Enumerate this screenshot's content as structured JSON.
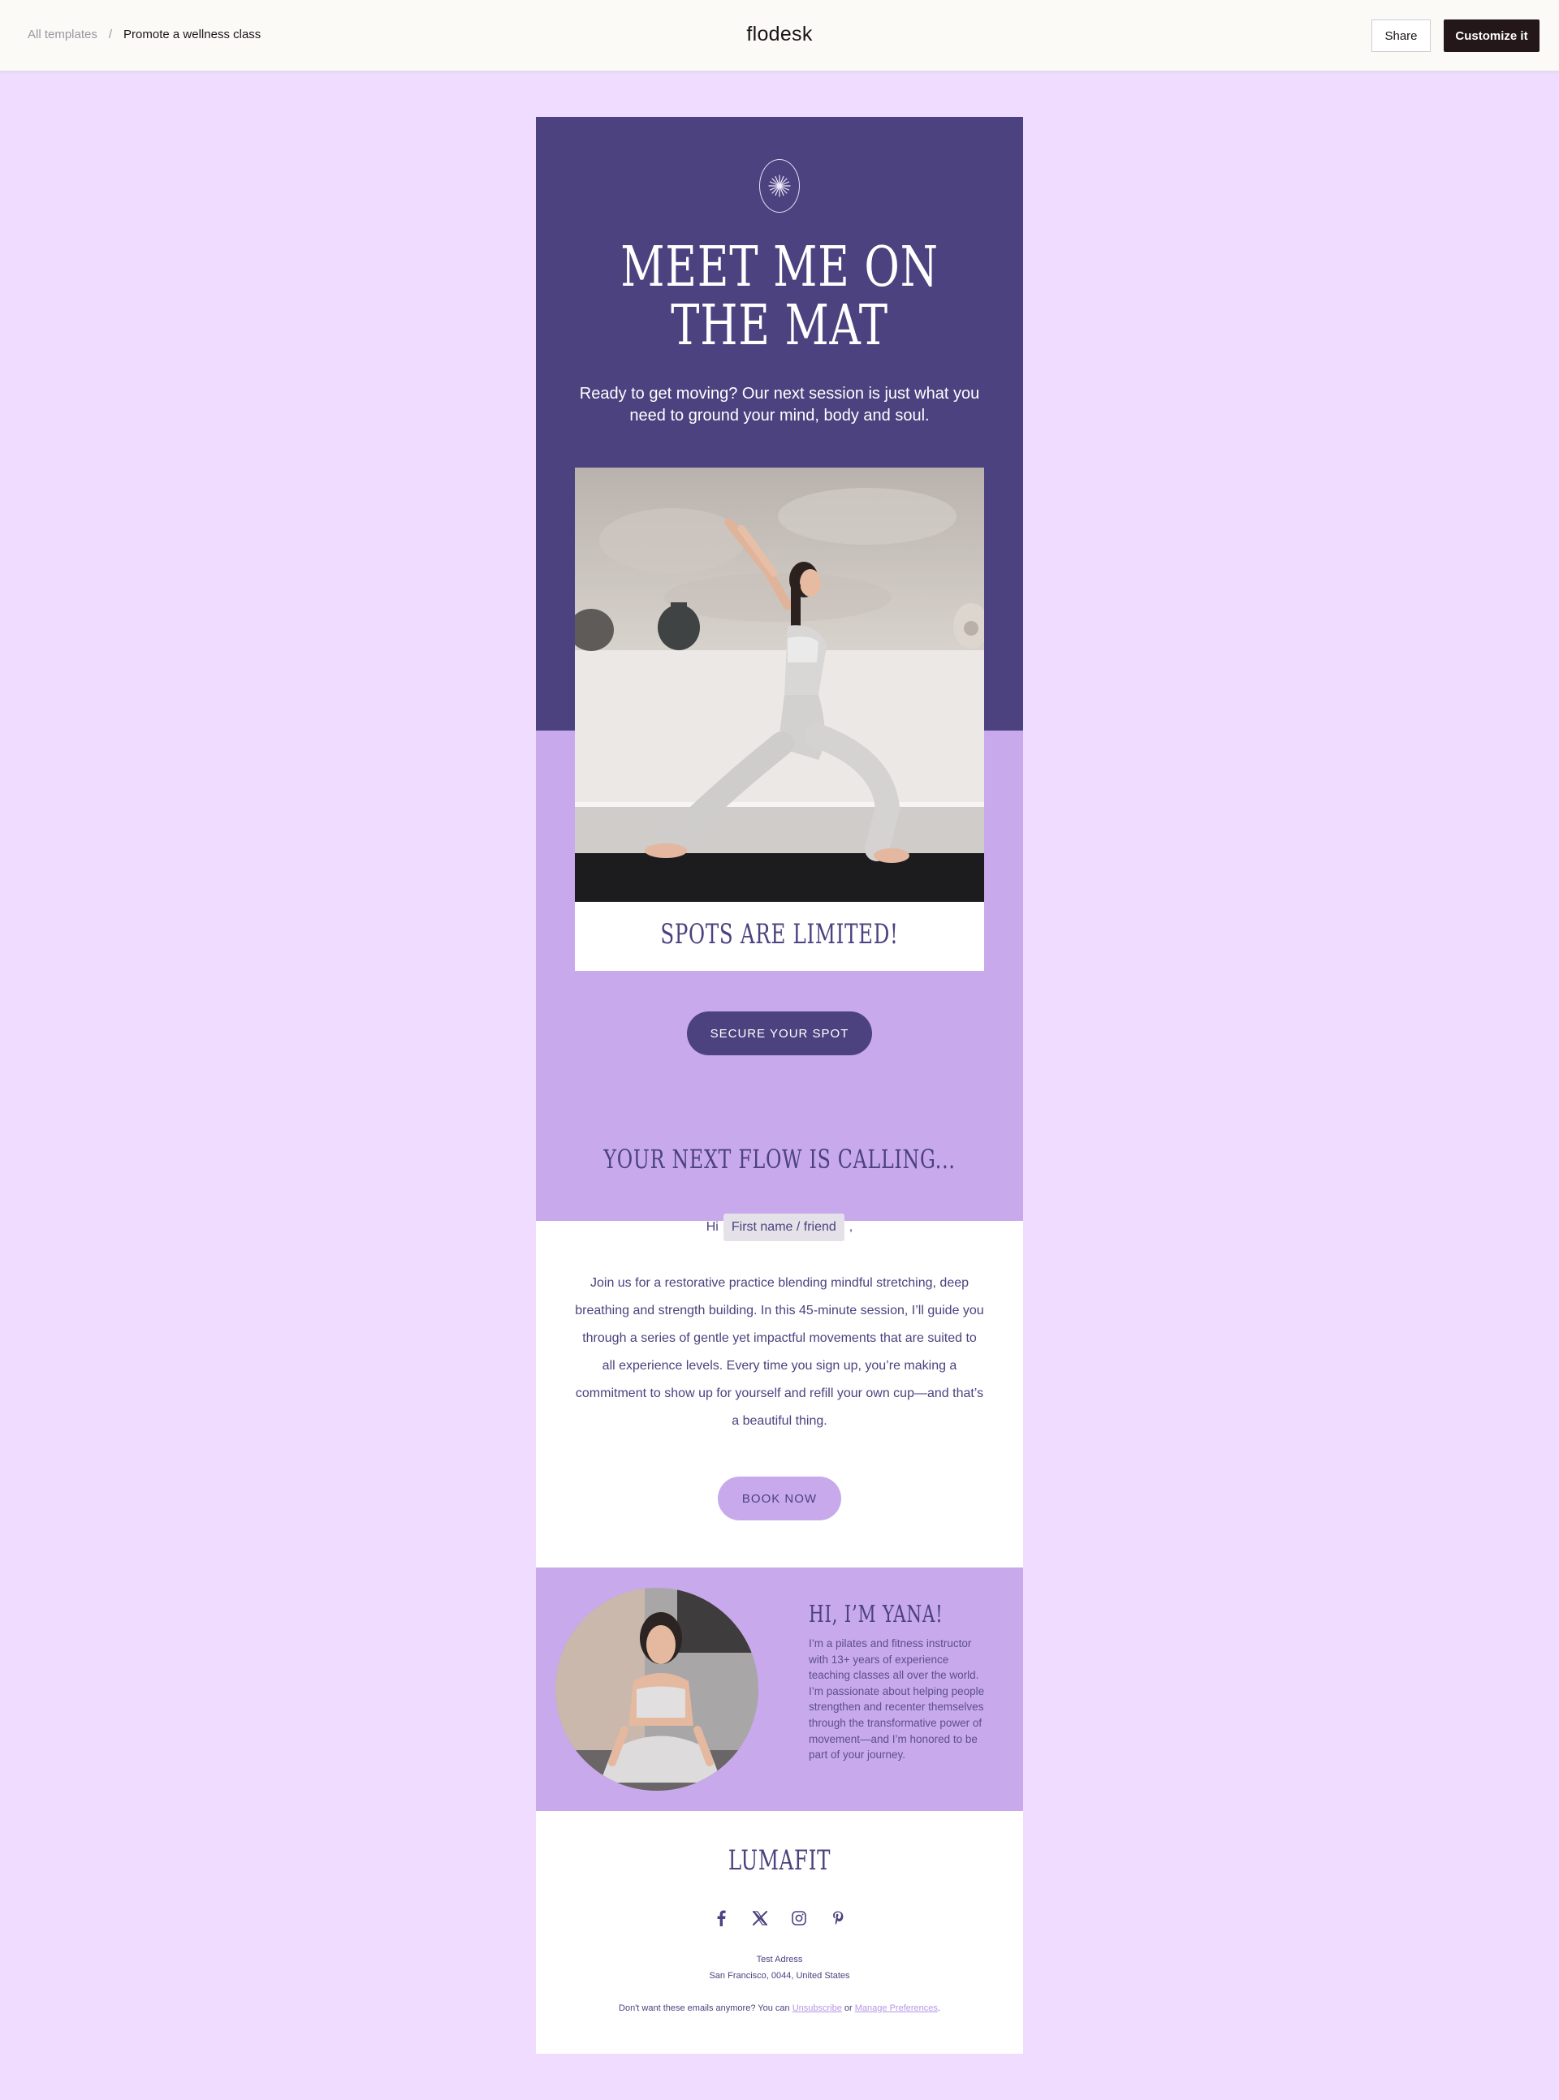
{
  "topbar": {
    "breadcrumb_parent": "All templates",
    "breadcrumb_sep": "/",
    "breadcrumb_current": "Promote a wellness class",
    "brand": "flodesk",
    "share_label": "Share",
    "customize_label": "Customize it"
  },
  "hero": {
    "title_line1": "MEET ME ON",
    "title_line2": "THE MAT",
    "subtitle": "Ready to get moving? Our next session is just what you need to ground your mind, body and soul.",
    "card_caption": "SPOTS ARE LIMITED!",
    "cta_label": "SECURE YOUR SPOT"
  },
  "flow": {
    "title": "YOUR NEXT FLOW IS CALLING...",
    "greeting_prefix": "Hi",
    "merge_tag": "First name / friend",
    "greeting_suffix": ",",
    "body": "Join us for a restorative practice blending mindful stretching, deep breathing and strength building. In this 45-minute session, I’ll guide you through a series of gentle yet impactful movements that are suited to all experience levels. Every time you sign up, you’re making a commitment to show up for yourself and refill your own cup—and that’s a beautiful thing.",
    "cta_label": "BOOK NOW"
  },
  "bio": {
    "title": "HI, I’M YANA!",
    "text": "I’m a pilates and fitness instructor with 13+ years of experience teaching classes all over the world. I’m passionate about helping people strengthen and recenter themselves through the transformative power of movement—and I’m honored to be part of your journey."
  },
  "footer": {
    "brand": "LUMAFIT",
    "social_icons": [
      "facebook-icon",
      "x-icon",
      "instagram-icon",
      "pinterest-icon"
    ],
    "address_line1": "Test Adress",
    "address_line2": "San Francisco, 0044, United States",
    "unsub_prefix": "Don't want these emails anymore? You can",
    "unsub_link": "Unsubscribe",
    "unsub_or": "or",
    "prefs_link": "Manage Preferences",
    "unsub_suffix": "."
  },
  "colors": {
    "page_bg": "#efdcff",
    "deep_purple": "#4b427f",
    "lavender": "#c8a9ec",
    "dark_button": "#231719"
  }
}
